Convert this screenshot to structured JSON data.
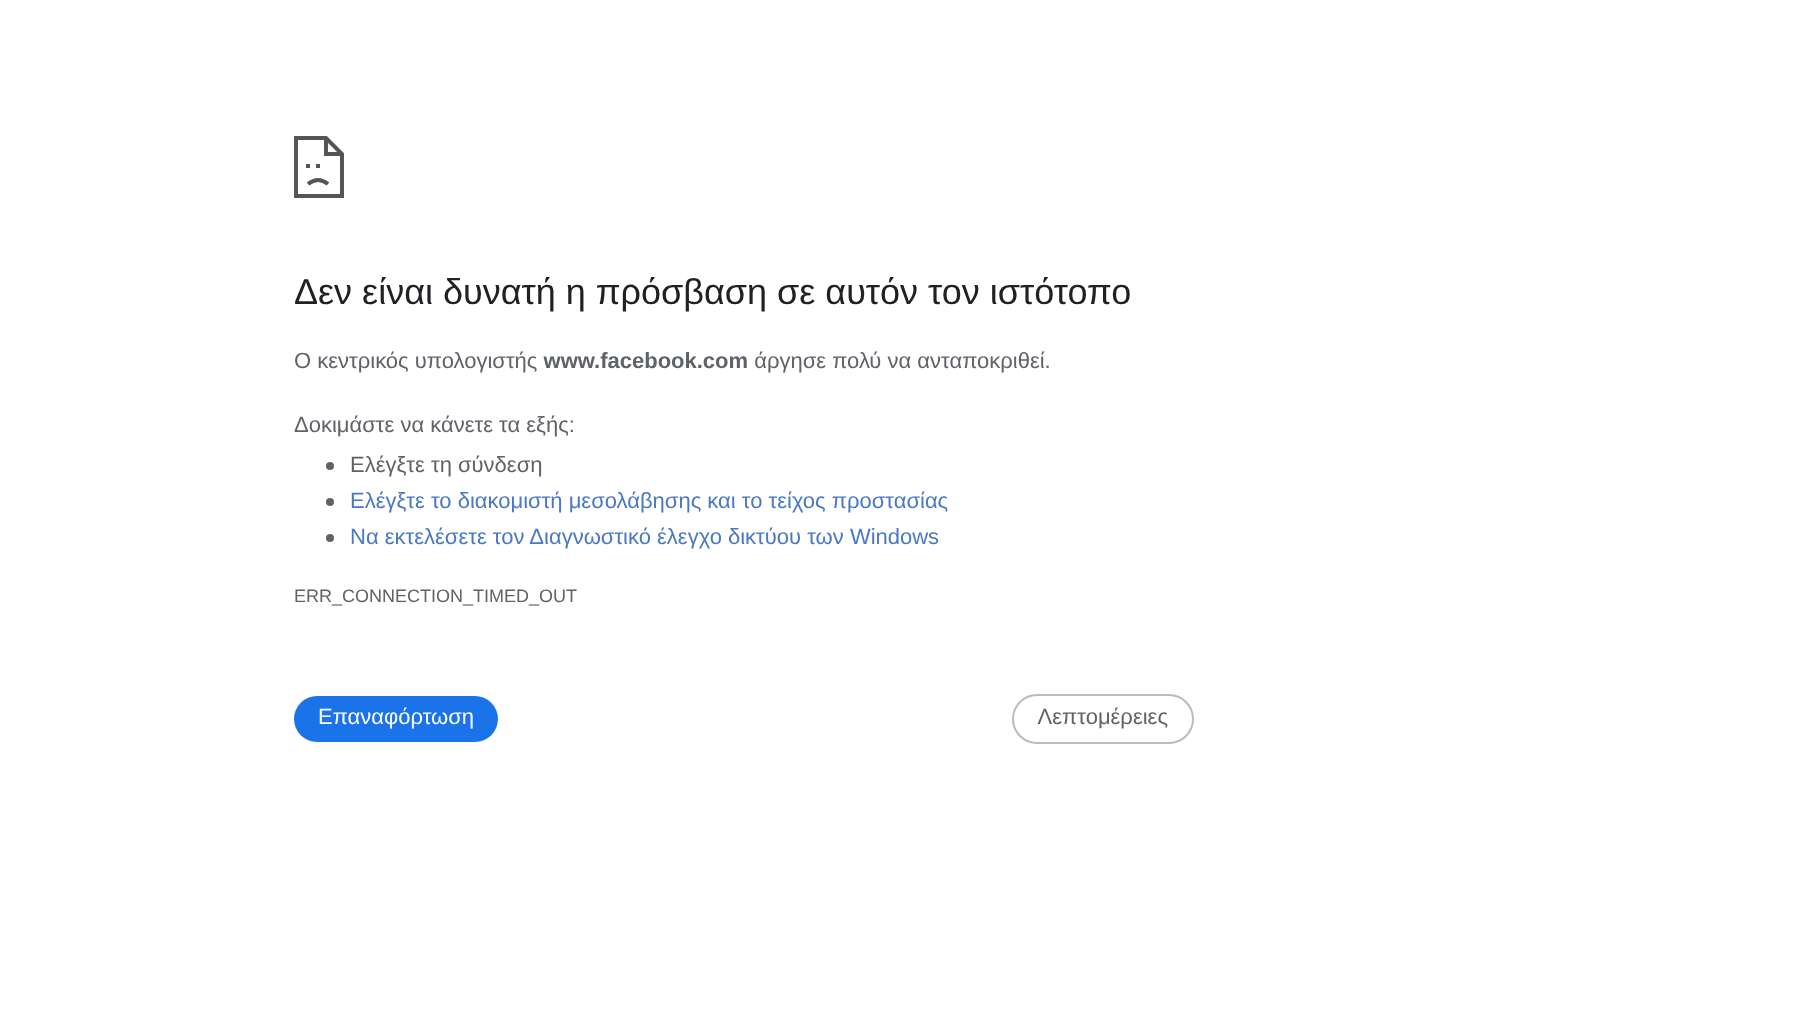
{
  "heading": "Δεν είναι δυνατή η πρόσβαση σε αυτόν τον ιστότοπο",
  "message": "Ο κεντρικός υπολογιστής **www.facebook.com** άργησε πολύ να ανταποκριθεί.",
  "suggestions_intro": "Δοκιμάστε να κάνετε τα εξής:",
  "suggestions": [
    {
      "kind": "text",
      "label": "Ελέγξτε τη σύνδεση"
    },
    {
      "kind": "link",
      "label": "Ελέγξτε το διακομιστή μεσολάβησης και το τείχος προστασίας"
    },
    {
      "kind": "link",
      "label": "Να εκτελέσετε τον Διαγνωστικό έλεγχο δικτύου των Windows"
    }
  ],
  "error_code": "ERR_CONNECTION_TIMED_OUT",
  "buttons": [
    {
      "kind": "primary",
      "label": "Επαναφόρτωση"
    },
    {
      "kind": "secondary",
      "label": "Λεπτομέρειες"
    }
  ]
}
